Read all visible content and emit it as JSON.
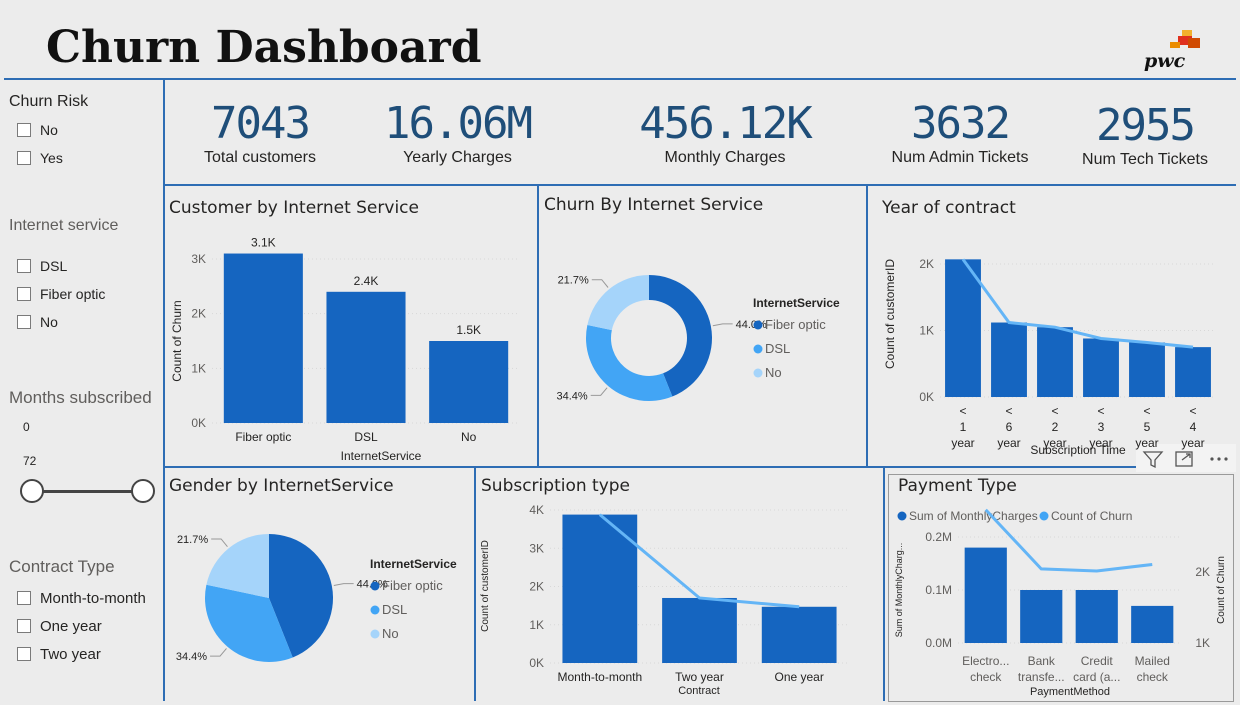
{
  "header": {
    "title": "Churn Dashboard",
    "logo_text": "pwc"
  },
  "slicers": {
    "churn_risk": {
      "title": "Churn Risk",
      "options": [
        "No",
        "Yes"
      ]
    },
    "internet_service": {
      "title": "Internet service",
      "options": [
        "DSL",
        "Fiber optic",
        "No"
      ]
    },
    "months": {
      "title": "Months subscribed",
      "min": "0",
      "max": "72"
    },
    "contract": {
      "title": "Contract Type",
      "options": [
        "Month-to-month",
        "One year",
        "Two year"
      ]
    }
  },
  "kpis": [
    {
      "value": "7043",
      "label": "Total customers"
    },
    {
      "value": "16.06M",
      "label": "Yearly Charges"
    },
    {
      "value": "456.12K",
      "label": "Monthly Charges"
    },
    {
      "value": "3632",
      "label": "Num Admin Tickets"
    },
    {
      "value": "2955",
      "label": "Num Tech Tickets"
    }
  ],
  "colors": {
    "dark": "#1565c0",
    "mid": "#42a5f5",
    "light": "#a5d4fa",
    "line": "#64b5f6",
    "border": "#2e6db4"
  },
  "chart_data": [
    {
      "type": "bar",
      "title": "Customer by Internet Service",
      "xlabel": "InternetService",
      "ylabel": "Count of Churn",
      "categories": [
        "Fiber optic",
        "DSL",
        "No"
      ],
      "values": [
        3100,
        2400,
        1500
      ],
      "data_labels": [
        "3.1K",
        "2.4K",
        "1.5K"
      ],
      "yticks": [
        "0K",
        "1K",
        "2K",
        "3K"
      ],
      "ylim": [
        0,
        3000
      ]
    },
    {
      "type": "pie",
      "donut": true,
      "title": "Churn By Internet Service",
      "legend_title": "InternetService",
      "categories": [
        "Fiber optic",
        "DSL",
        "No"
      ],
      "values": [
        44.0,
        34.4,
        21.7
      ],
      "data_labels": [
        "44.0%",
        "34.4%",
        "21.7%"
      ]
    },
    {
      "type": "bar",
      "title": "Year of contract",
      "xlabel": "Subscription Time",
      "ylabel": "Count of customerID",
      "categories": [
        "< 1 year",
        "< 6 year",
        "< 2 year",
        "< 3 year",
        "< 5 year",
        "< 4 year"
      ],
      "values": [
        2070,
        1120,
        1050,
        880,
        820,
        750
      ],
      "line_values": [
        2070,
        1120,
        1050,
        880,
        820,
        750
      ],
      "yticks": [
        "0K",
        "1K",
        "2K"
      ],
      "ylim": [
        0,
        2000
      ]
    },
    {
      "type": "pie",
      "title": "Gender by InternetService",
      "legend_title": "InternetService",
      "categories": [
        "Fiber optic",
        "DSL",
        "No"
      ],
      "values": [
        44.0,
        34.4,
        21.7
      ],
      "data_labels": [
        "44.0%",
        "34.4%",
        "21.7%"
      ]
    },
    {
      "type": "bar",
      "title": "Subscription type",
      "xlabel": "Contract",
      "ylabel": "Count of customerID",
      "categories": [
        "Month-to-month",
        "Two year",
        "One year"
      ],
      "values": [
        3880,
        1700,
        1470
      ],
      "line_values": [
        3880,
        1700,
        1470
      ],
      "yticks": [
        "0K",
        "1K",
        "2K",
        "3K",
        "4K"
      ],
      "ylim": [
        0,
        4000
      ]
    },
    {
      "type": "bar",
      "title": "Payment Type",
      "xlabel": "PaymentMethod",
      "ylabel": "Sum of MonthlyCharg...",
      "y2label": "Count of Churn",
      "legend": [
        "Sum of MonthlyCharges",
        "Count of Churn"
      ],
      "categories": [
        "Electro... check",
        "Bank transfe...",
        "Credit card (a...",
        "Mailed check"
      ],
      "values": [
        0.18,
        0.1,
        0.1,
        0.07
      ],
      "line_values": [
        2360,
        1550,
        1520,
        1610
      ],
      "yticks": [
        "0.0M",
        "0.1M",
        "0.2M"
      ],
      "y2ticks": [
        "1K",
        "2K"
      ],
      "ylim": [
        0,
        0.2
      ],
      "y2lim": [
        1000,
        2000
      ]
    }
  ]
}
